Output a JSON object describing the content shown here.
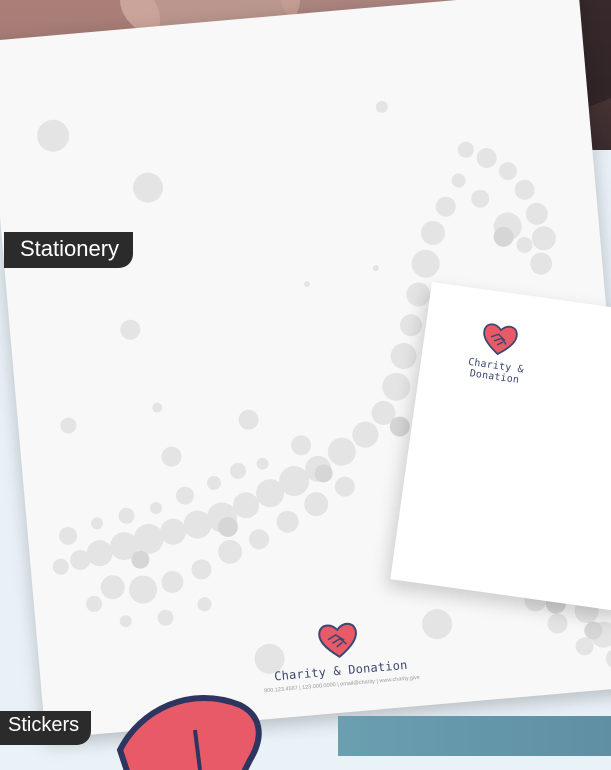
{
  "sections": {
    "stationery_label": "Stationery",
    "stickers_label": "Stickers"
  },
  "brand": {
    "name": "Charity & Donation",
    "contact_line": "800.123.4567 | 123.000.0000 | email@charity | www.charity.give",
    "logo_icon": "heart-handshake-icon",
    "colors": {
      "logo_red": "#e85a68",
      "logo_outline": "#3d4770",
      "label_bg": "#2b2b2b",
      "teal": "#6a9fb0"
    }
  },
  "envelope": {
    "name": "Charity & Donation"
  }
}
